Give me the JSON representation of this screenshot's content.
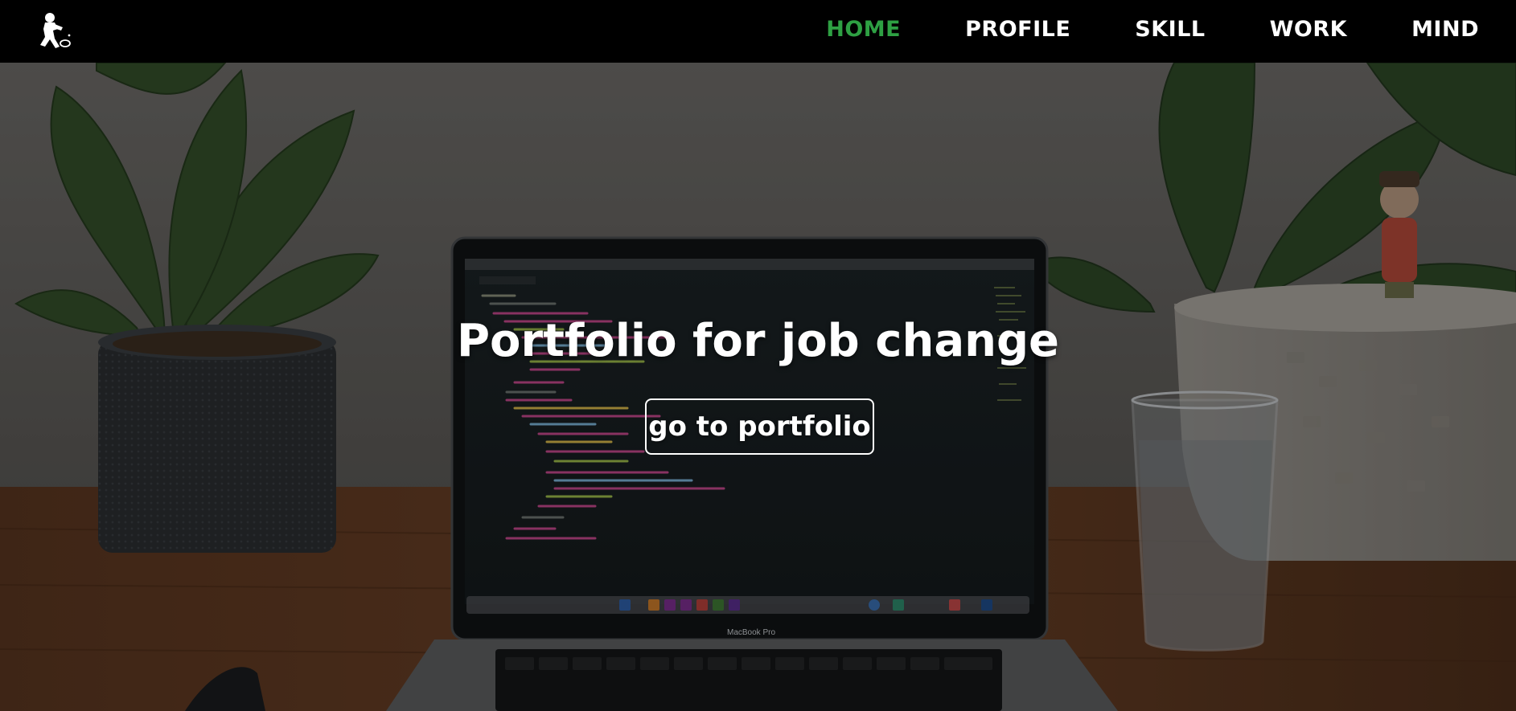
{
  "header": {
    "logo_icon": "running-figure-icon",
    "nav": [
      {
        "label": "HOME",
        "active": true
      },
      {
        "label": "PROFILE",
        "active": false
      },
      {
        "label": "SKILL",
        "active": false
      },
      {
        "label": "WORK",
        "active": false
      },
      {
        "label": "MIND",
        "active": false
      }
    ]
  },
  "hero": {
    "title": "Portfolio for job change",
    "button_label": "go to portfolio",
    "laptop_label": "MacBook Pro"
  },
  "colors": {
    "accent_active_nav": "#2ea043",
    "header_bg": "#000000",
    "text": "#ffffff"
  }
}
